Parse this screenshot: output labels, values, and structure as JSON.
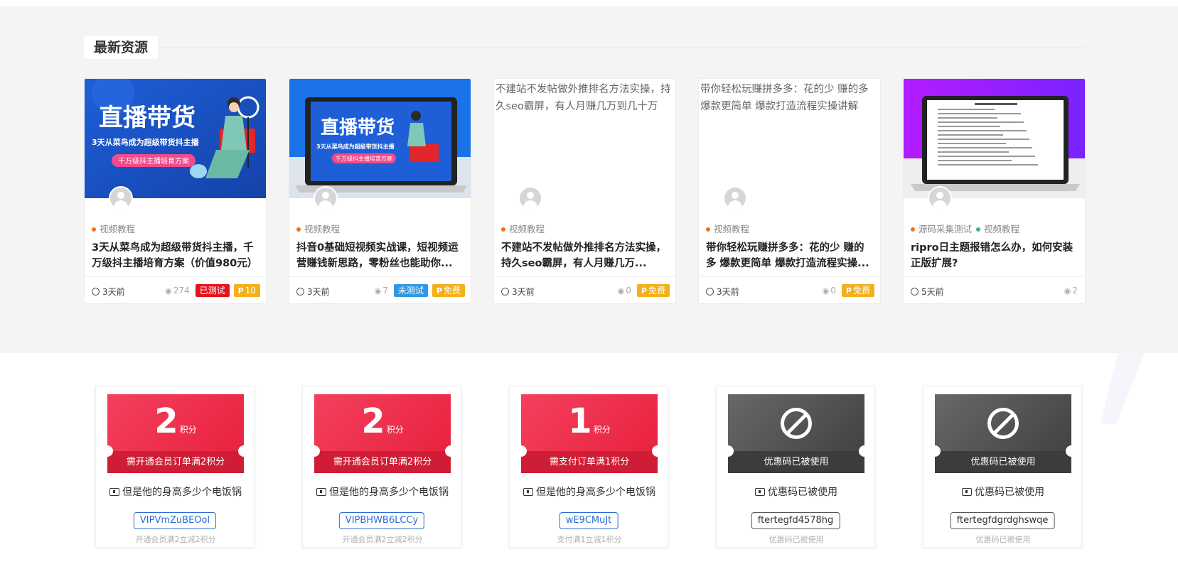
{
  "section": {
    "title": "最新资源"
  },
  "cards": [
    {
      "thumb": "live",
      "thumb_title": "直播带货",
      "thumb_sub": "3天从菜鸟成为超级带货抖主播",
      "thumb_tag": "千万级抖主播培育方案",
      "categories": [
        {
          "name": "视频教程",
          "color": "#f37021"
        }
      ],
      "title": "3天从菜鸟成为超级带货抖主播，千万级抖主播培育方案（价值980元）",
      "time": "3天前",
      "views": "274",
      "badges": [
        {
          "label": "已测试",
          "style": "red",
          "coin": false
        },
        {
          "label": "10",
          "style": "gold",
          "coin": true
        }
      ]
    },
    {
      "thumb": "laptop-live",
      "thumb_title": "直播带货",
      "thumb_sub": "3天从菜鸟成为超级带货抖主播",
      "thumb_tag": "千万级抖主播培育方案",
      "categories": [
        {
          "name": "视频教程",
          "color": "#f37021"
        }
      ],
      "title": "抖音0基础短视频实战课，短视频运营赚钱新思路，零粉丝也能助你...",
      "time": "3天前",
      "views": "7",
      "badges": [
        {
          "label": "未测试",
          "style": "blue",
          "coin": false
        },
        {
          "label": "免费",
          "style": "gold",
          "coin": true
        }
      ]
    },
    {
      "thumb": "broken",
      "thumb_alt": "不建站不发帖做外推排名方法实操，持久seo霸屏，有人月赚几万到几十万",
      "categories": [
        {
          "name": "视频教程",
          "color": "#f37021"
        }
      ],
      "title": "不建站不发帖做外推排名方法实操，持久seo霸屏，有人月赚几万...",
      "time": "3天前",
      "views": "0",
      "badges": [
        {
          "label": "免费",
          "style": "gold",
          "coin": true
        }
      ]
    },
    {
      "thumb": "broken",
      "thumb_alt": "带你轻松玩赚拼多多：花的少 赚的多 爆款更简单 爆款打造流程实操讲解",
      "categories": [
        {
          "name": "视频教程",
          "color": "#f37021"
        }
      ],
      "title": "带你轻松玩赚拼多多：花的少 赚的多 爆款更简单 爆款打造流程实操...",
      "time": "3天前",
      "views": "0",
      "badges": [
        {
          "label": "免费",
          "style": "gold",
          "coin": true
        }
      ]
    },
    {
      "thumb": "laptop-doc",
      "categories": [
        {
          "name": "源码采集测试",
          "color": "#f37021"
        },
        {
          "name": "视频教程",
          "color": "#3cb371"
        }
      ],
      "title": "ripro日主题报错怎么办，如何安装正版扩展?",
      "time": "5天前",
      "views": "2",
      "badges": []
    }
  ],
  "coupons": [
    {
      "style": "red",
      "amount": "2",
      "unit": "积分",
      "ticket_label": "需开通会员订单满2积分",
      "name": "但是他的身高多少个电饭锅",
      "code": "VIPVmZuBEOol",
      "desc": "开通会员满2立减2积分"
    },
    {
      "style": "red",
      "amount": "2",
      "unit": "积分",
      "ticket_label": "需开通会员订单满2积分",
      "name": "但是他的身高多少个电饭锅",
      "code": "VIPBHWB6LCCy",
      "desc": "开通会员满2立减2积分"
    },
    {
      "style": "red",
      "amount": "1",
      "unit": "积分",
      "ticket_label": "需支付订单满1积分",
      "name": "但是他的身高多少个电饭锅",
      "code": "wE9CMuJt",
      "desc": "支付满1立减1积分"
    },
    {
      "style": "gray",
      "amount": "",
      "unit": "",
      "ticket_label": "优惠码已被使用",
      "name": "优惠码已被使用",
      "code": "ftertegfd4578hg",
      "desc": "优惠码已被使用"
    },
    {
      "style": "gray",
      "amount": "",
      "unit": "",
      "ticket_label": "优惠码已被使用",
      "name": "优惠码已被使用",
      "code": "ftertegfdgrdghswqe",
      "desc": "优惠码已被使用"
    }
  ]
}
